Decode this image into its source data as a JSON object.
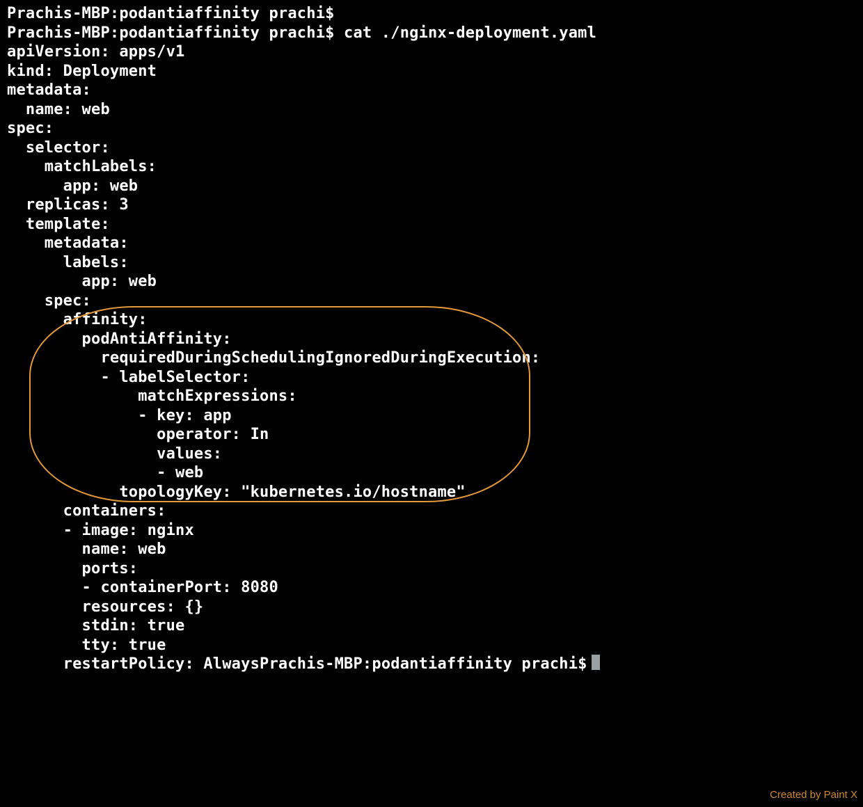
{
  "prompts": {
    "p1": "Prachis-MBP:podantiaffinity prachi$",
    "p2": "Prachis-MBP:podantiaffinity prachi$ cat ./nginx-deployment.yaml"
  },
  "yaml": {
    "l01": "apiVersion: apps/v1",
    "l02": "kind: Deployment",
    "l03": "metadata:",
    "l04": "  name: web",
    "l05": "spec:",
    "l06": "  selector:",
    "l07": "    matchLabels:",
    "l08": "      app: web",
    "l09": "  replicas: 3",
    "l10": "  template:",
    "l11": "    metadata:",
    "l12": "      labels:",
    "l13": "        app: web",
    "l14": "    spec:",
    "l15": "      affinity:",
    "l16": "        podAntiAffinity:",
    "l17": "          requiredDuringSchedulingIgnoredDuringExecution:",
    "l18": "          - labelSelector:",
    "l19": "              matchExpressions:",
    "l20": "              - key: app",
    "l21": "                operator: In",
    "l22": "                values:",
    "l23": "                - web",
    "l24": "            topologyKey: \"kubernetes.io/hostname\"",
    "l25": "      containers:",
    "l26": "      - image: nginx",
    "l27": "        name: web",
    "l28": "        ports:",
    "l29": "        - containerPort: 8080",
    "l30": "        resources: {}",
    "l31": "        stdin: true",
    "l32": "        tty: true",
    "l33_prefix": "      restartPolicy: Always",
    "l33_prompt": "Prachis-MBP:podantiaffinity prachi$"
  },
  "watermark": "Created by Paint X"
}
